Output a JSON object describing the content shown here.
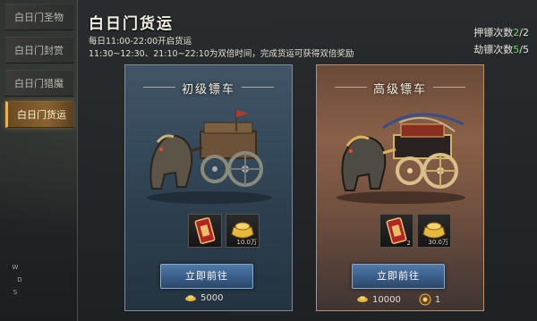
{
  "sidebar": {
    "items": [
      {
        "label": "白日门圣物",
        "active": false
      },
      {
        "label": "白日门封赏",
        "active": false
      },
      {
        "label": "白日门猎魔",
        "active": false
      },
      {
        "label": "白日门货运",
        "active": true
      }
    ]
  },
  "panel": {
    "title": "白日门货运",
    "info_line1": "每日11:00-22:00开启货运",
    "info_line2": "11:30~12:30、21:10~22:10为双倍时间，完成货运可获得双倍奖励",
    "escort_label": "押镖次数",
    "escort_used": "2",
    "escort_total": "/2",
    "rob_label": "劫镖次数",
    "rob_used": "5",
    "rob_total": "/5"
  },
  "carts": {
    "basic": {
      "title": "初级镖车",
      "reward1_count": "",
      "reward2_count": "10.0万",
      "button": "立即前往",
      "cost": "5000"
    },
    "advanced": {
      "title": "高级镖车",
      "reward1_count": "2",
      "reward2_count": "30.0万",
      "button": "立即前往",
      "cost": "10000",
      "extra_cost": "1"
    }
  },
  "compass": {
    "n": "W",
    "e": "D",
    "s": "S"
  },
  "colors": {
    "accent": "#e8b25a",
    "count_green": "#6fd860",
    "button_blue": "#3a5d88"
  }
}
